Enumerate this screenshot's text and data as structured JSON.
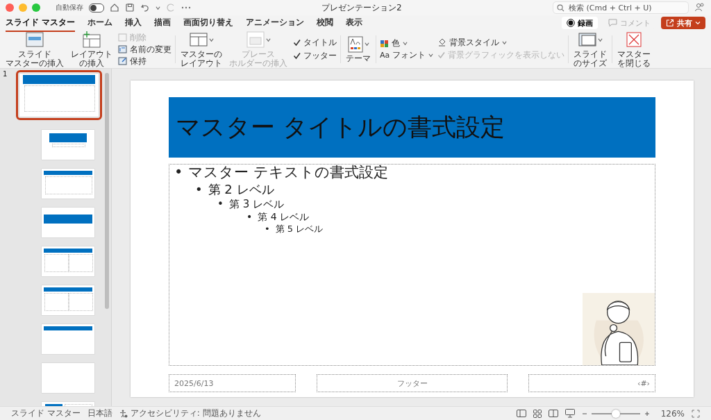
{
  "window": {
    "title": "プレゼンテーション2",
    "autosave_label": "自動保存",
    "autosave_on": false
  },
  "search": {
    "placeholder": "検索 (Cmd + Ctrl + U)"
  },
  "tabs": [
    {
      "label": "スライド マスター",
      "selected": true
    },
    {
      "label": "ホーム",
      "selected": false
    },
    {
      "label": "挿入",
      "selected": false
    },
    {
      "label": "描画",
      "selected": false
    },
    {
      "label": "画面切り替え",
      "selected": false
    },
    {
      "label": "アニメーション",
      "selected": false
    },
    {
      "label": "校閲",
      "selected": false
    },
    {
      "label": "表示",
      "selected": false
    }
  ],
  "actions": {
    "record": "録画",
    "comment": "コメント",
    "comment_disabled": true,
    "share": "共有"
  },
  "ribbon": [
    {
      "columns": [
        [
          {
            "kind": "large",
            "lines": [
              "スライド",
              "マスターの挿入"
            ],
            "disabled": false,
            "dropdown": false
          }
        ],
        [
          {
            "kind": "large",
            "lines": [
              "レイアウト",
              "の挿入"
            ],
            "disabled": false,
            "dropdown": false
          }
        ],
        [
          {
            "kind": "small",
            "label": "削除",
            "disabled": true,
            "dropdown": false
          },
          {
            "kind": "small",
            "label": "名前の変更",
            "disabled": false,
            "dropdown": false
          },
          {
            "kind": "small",
            "label": "保持",
            "disabled": false,
            "dropdown": false
          }
        ]
      ]
    },
    {
      "columns": [
        [
          {
            "kind": "large",
            "lines": [
              "マスターの",
              "レイアウト"
            ],
            "disabled": false,
            "dropdown": true
          }
        ],
        [
          {
            "kind": "large",
            "lines": [
              "プレース",
              "ホルダーの挿入"
            ],
            "disabled": true,
            "dropdown": true
          }
        ],
        [
          {
            "kind": "check",
            "label": "タイトル",
            "checked": true,
            "disabled": false
          },
          {
            "kind": "check",
            "label": "フッター",
            "checked": true,
            "disabled": false
          }
        ]
      ]
    },
    {
      "columns": [
        [
          {
            "kind": "large",
            "lines": [
              "テーマ"
            ],
            "disabled": false,
            "dropdown": true
          }
        ]
      ]
    },
    {
      "columns": [
        [
          {
            "kind": "small",
            "label": "色",
            "disabled": false,
            "dropdown": true
          },
          {
            "kind": "small",
            "glyph": "Aa",
            "label": "フォント",
            "disabled": false,
            "dropdown": true
          }
        ],
        [
          {
            "kind": "small",
            "label": "背景スタイル",
            "disabled": false,
            "dropdown": true
          },
          {
            "kind": "check",
            "label": "背景グラフィックを表示しない",
            "checked": true,
            "disabled": true
          }
        ]
      ]
    },
    {
      "columns": [
        [
          {
            "kind": "large",
            "lines": [
              "スライド",
              "のサイズ"
            ],
            "disabled": false,
            "dropdown": true
          }
        ]
      ]
    },
    {
      "columns": [
        [
          {
            "kind": "large",
            "lines": [
              "マスター",
              "を閉じる"
            ],
            "disabled": false,
            "dropdown": false
          }
        ]
      ]
    }
  ],
  "thumbnails": [
    {
      "kind": "master",
      "selected": true,
      "number": "1"
    },
    {
      "kind": "title-slide",
      "selected": false
    },
    {
      "kind": "title-content",
      "selected": false
    },
    {
      "kind": "section",
      "selected": false
    },
    {
      "kind": "two-content",
      "selected": false
    },
    {
      "kind": "comparison",
      "selected": false
    },
    {
      "kind": "title-only",
      "selected": false
    },
    {
      "kind": "blank",
      "selected": false
    },
    {
      "kind": "content-caption",
      "selected": false
    }
  ],
  "slide": {
    "title": "マスター タイトルの書式設定",
    "body": [
      {
        "bullet": "•",
        "text": "マスター テキストの書式設定",
        "children": [
          {
            "bullet": "•",
            "text": "第 2 レベル",
            "children": [
              {
                "bullet": "•",
                "text": "第 3 レベル",
                "children": [
                  {
                    "bullet": "•",
                    "text": "第 4 レベル",
                    "children": [
                      {
                        "bullet": "•",
                        "text": "第 5 レベル"
                      }
                    ]
                  }
                ]
              }
            ]
          }
        ]
      }
    ],
    "date": "2025/6/13",
    "footer": "フッター",
    "number": "‹#›"
  },
  "status_bar": {
    "view": "スライド マスター",
    "language": "日本語",
    "accessibility": "アクセシビリティ: 問題ありません",
    "zoom": {
      "level": 0.5,
      "reading": "126%"
    }
  }
}
